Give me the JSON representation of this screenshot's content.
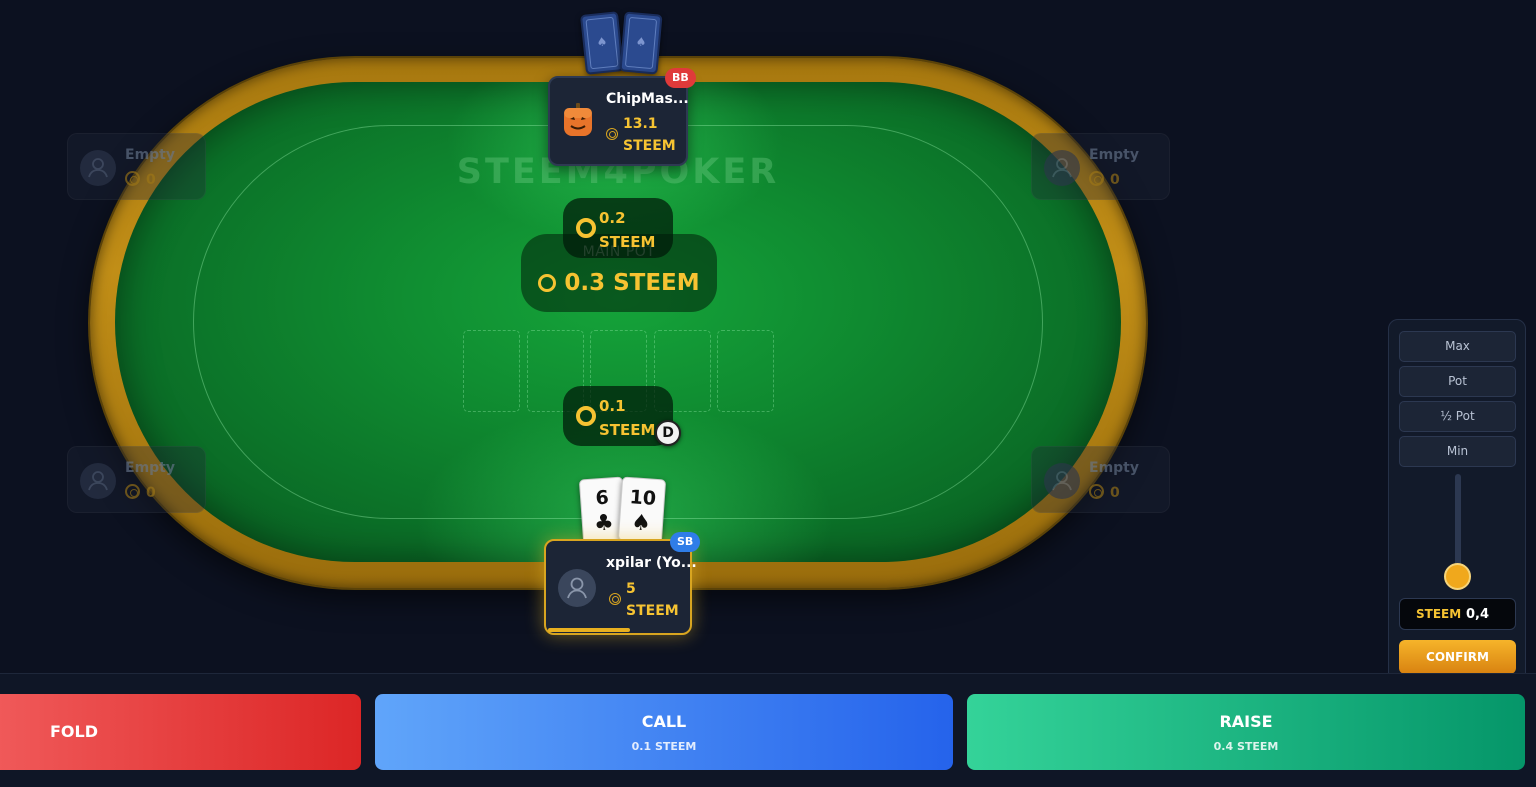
{
  "table": {
    "brand": "STEEM4POKER",
    "pot_label": "MAIN POT",
    "pot_amount": "0.3 STEEM"
  },
  "bets": {
    "top_line1": "0.2",
    "top_line2": "STEEM",
    "hero_line1": "0.1",
    "hero_line2": "STEEM"
  },
  "dealer_button": "D",
  "empty_seats": [
    {
      "name": "Empty",
      "stack": "0"
    },
    {
      "name": "Empty",
      "stack": "0"
    },
    {
      "name": "Empty",
      "stack": "0"
    },
    {
      "name": "Empty",
      "stack": "0"
    }
  ],
  "players": {
    "top": {
      "name": "ChipMas...",
      "stack_amount": "13.1",
      "stack_unit": "STEEM",
      "badge": "BB",
      "card_back_pip": "♠"
    },
    "hero": {
      "name": "xpilar (Yo...",
      "stack_amount": "5",
      "stack_unit": "STEEM",
      "badge": "SB",
      "turn_timer_fraction": 0.57,
      "cards": [
        {
          "rank": "6",
          "suit": "♣"
        },
        {
          "rank": "10",
          "suit": "♠"
        }
      ]
    }
  },
  "sizing_panel": {
    "presets": [
      "Max",
      "Pot",
      "½ Pot",
      "Min"
    ],
    "slider_value_fraction": 0.0,
    "amount_unit": "STEEM",
    "amount_value": "0,4",
    "confirm_label": "CONFIRM"
  },
  "actions": {
    "fold_label": "FOLD",
    "call_label": "CALL",
    "call_amount": "0.1 STEEM",
    "raise_label": "RAISE",
    "raise_amount": "0.4 STEEM"
  },
  "colors": {
    "accent_gold": "#f6c332",
    "felt": "#0f8a30",
    "fold": "#dc2626",
    "call": "#2563eb",
    "raise": "#059669"
  }
}
